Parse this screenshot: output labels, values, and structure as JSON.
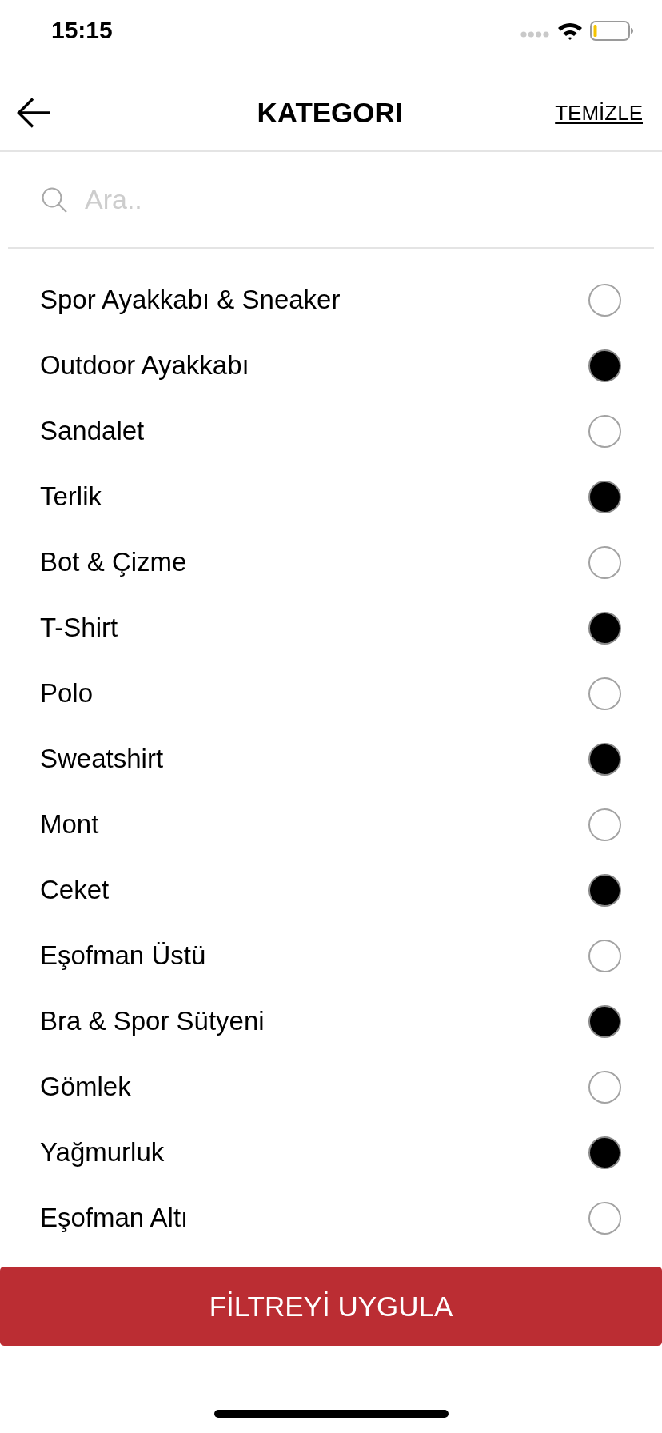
{
  "status_bar": {
    "time": "15:15"
  },
  "header": {
    "title": "KATEGORI",
    "clear_link": "TEMİZLE"
  },
  "search": {
    "placeholder": "Ara.."
  },
  "categories": [
    {
      "label": "Spor Ayakkabı & Sneaker",
      "selected": false
    },
    {
      "label": "Outdoor Ayakkabı",
      "selected": true
    },
    {
      "label": "Sandalet",
      "selected": false
    },
    {
      "label": "Terlik",
      "selected": true
    },
    {
      "label": "Bot & Çizme",
      "selected": false
    },
    {
      "label": "T-Shirt",
      "selected": true
    },
    {
      "label": "Polo",
      "selected": false
    },
    {
      "label": "Sweatshirt",
      "selected": true
    },
    {
      "label": "Mont",
      "selected": false
    },
    {
      "label": "Ceket",
      "selected": true
    },
    {
      "label": "Eşofman Üstü",
      "selected": false
    },
    {
      "label": "Bra & Spor Sütyeni",
      "selected": true
    },
    {
      "label": "Gömlek",
      "selected": false
    },
    {
      "label": "Yağmurluk",
      "selected": true
    },
    {
      "label": "Eşofman Altı",
      "selected": false
    }
  ],
  "apply_button": {
    "label": "FİLTREYİ UYGULA"
  }
}
